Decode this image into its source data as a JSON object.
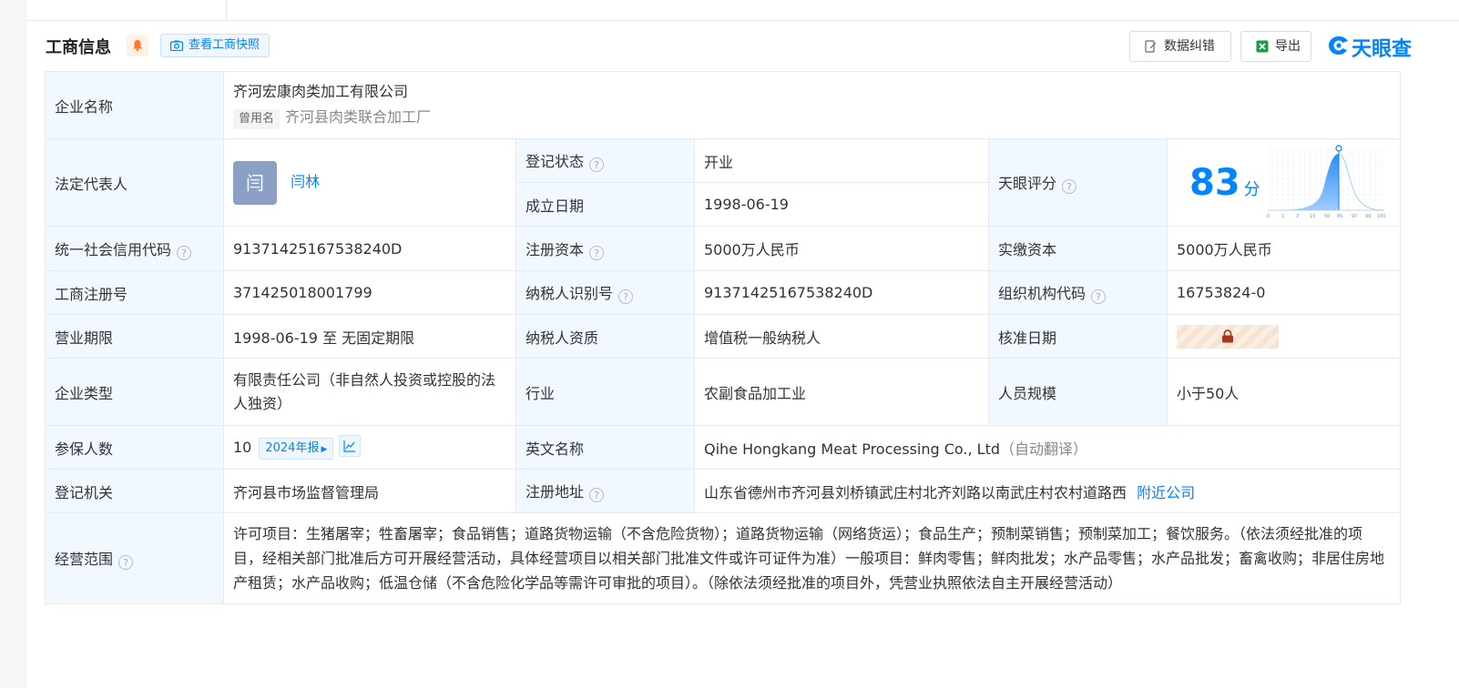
{
  "section": {
    "title": "工商信息",
    "snapshot_label": "查看工商快照",
    "fix_label": "数据纠错",
    "export_label": "导出",
    "logo_text": "天眼查"
  },
  "labels": {
    "company_name": "企业名称",
    "legal_rep": "法定代表人",
    "reg_status": "登记状态",
    "founded": "成立日期",
    "score": "天眼评分",
    "credit_code": "统一社会信用代码",
    "reg_capital": "注册资本",
    "paid_capital": "实缴资本",
    "reg_number": "工商注册号",
    "taxpayer_id": "纳税人识别号",
    "org_code": "组织机构代码",
    "term": "营业期限",
    "taxpayer_type": "纳税人资质",
    "approval_date": "核准日期",
    "company_type": "企业类型",
    "industry": "行业",
    "staff_size": "人员规模",
    "insured": "参保人数",
    "english_name": "英文名称",
    "authority": "登记机关",
    "address": "注册地址",
    "scope": "经营范围"
  },
  "values": {
    "company_name": "齐河宏康肉类加工有限公司",
    "former_name_tag": "曾用名",
    "former_name": "齐河县肉类联合加工厂",
    "legal_rep_avatar": "闫",
    "legal_rep": "闫林",
    "reg_status": "开业",
    "founded": "1998-06-19",
    "score_value": "83",
    "score_unit": "分",
    "credit_code": "91371425167538240D",
    "reg_capital": "5000万人民币",
    "paid_capital": "5000万人民币",
    "reg_number": "371425018001799",
    "taxpayer_id": "91371425167538240D",
    "org_code": "16753824-0",
    "term": "1998-06-19 至 无固定期限",
    "taxpayer_type": "增值税一般纳税人",
    "company_type": "有限责任公司（非自然人投资或控股的法人独资）",
    "industry": "农副食品加工业",
    "staff_size": "小于50人",
    "insured": "10",
    "insured_year": "2024年报",
    "english_name": "Qihe Hongkang Meat Processing Co., Ltd",
    "english_note": "（自动翻译）",
    "authority": "齐河县市场监督管理局",
    "address": "山东省德州市齐河县刘桥镇武庄村北齐刘路以南武庄村农村道路西",
    "nearby": "附近公司",
    "scope": "许可项目：生猪屠宰；牲畜屠宰；食品销售；道路货物运输（不含危险货物）；道路货物运输（网络货运）；食品生产；预制菜销售；预制菜加工；餐饮服务。（依法须经批准的项目，经相关部门批准后方可开展经营活动，具体经营项目以相关部门批准文件或许可证件为准）一般项目：鲜肉零售；鲜肉批发；水产品零售；水产品批发；畜禽收购；非居住房地产租赁；水产品收购；低温仓储（不含危险化学品等需许可审批的项目）。（除依法须经批准的项目外，凭营业执照依法自主开展经营活动）"
  },
  "score_chart": {
    "ticks": [
      "0",
      "1",
      "3",
      "15",
      "50",
      "85",
      "97",
      "99",
      "100"
    ]
  },
  "colors": {
    "accent": "#0084ff",
    "label_bg": "#f2f8ff",
    "border": "#e4eaf4",
    "status_green": "#00a85a"
  },
  "icons": [
    "bell-icon",
    "camera-icon",
    "edit-icon",
    "excel-icon",
    "tianyancha-logo-icon",
    "help-icon",
    "lock-icon",
    "trend-chart-icon"
  ]
}
